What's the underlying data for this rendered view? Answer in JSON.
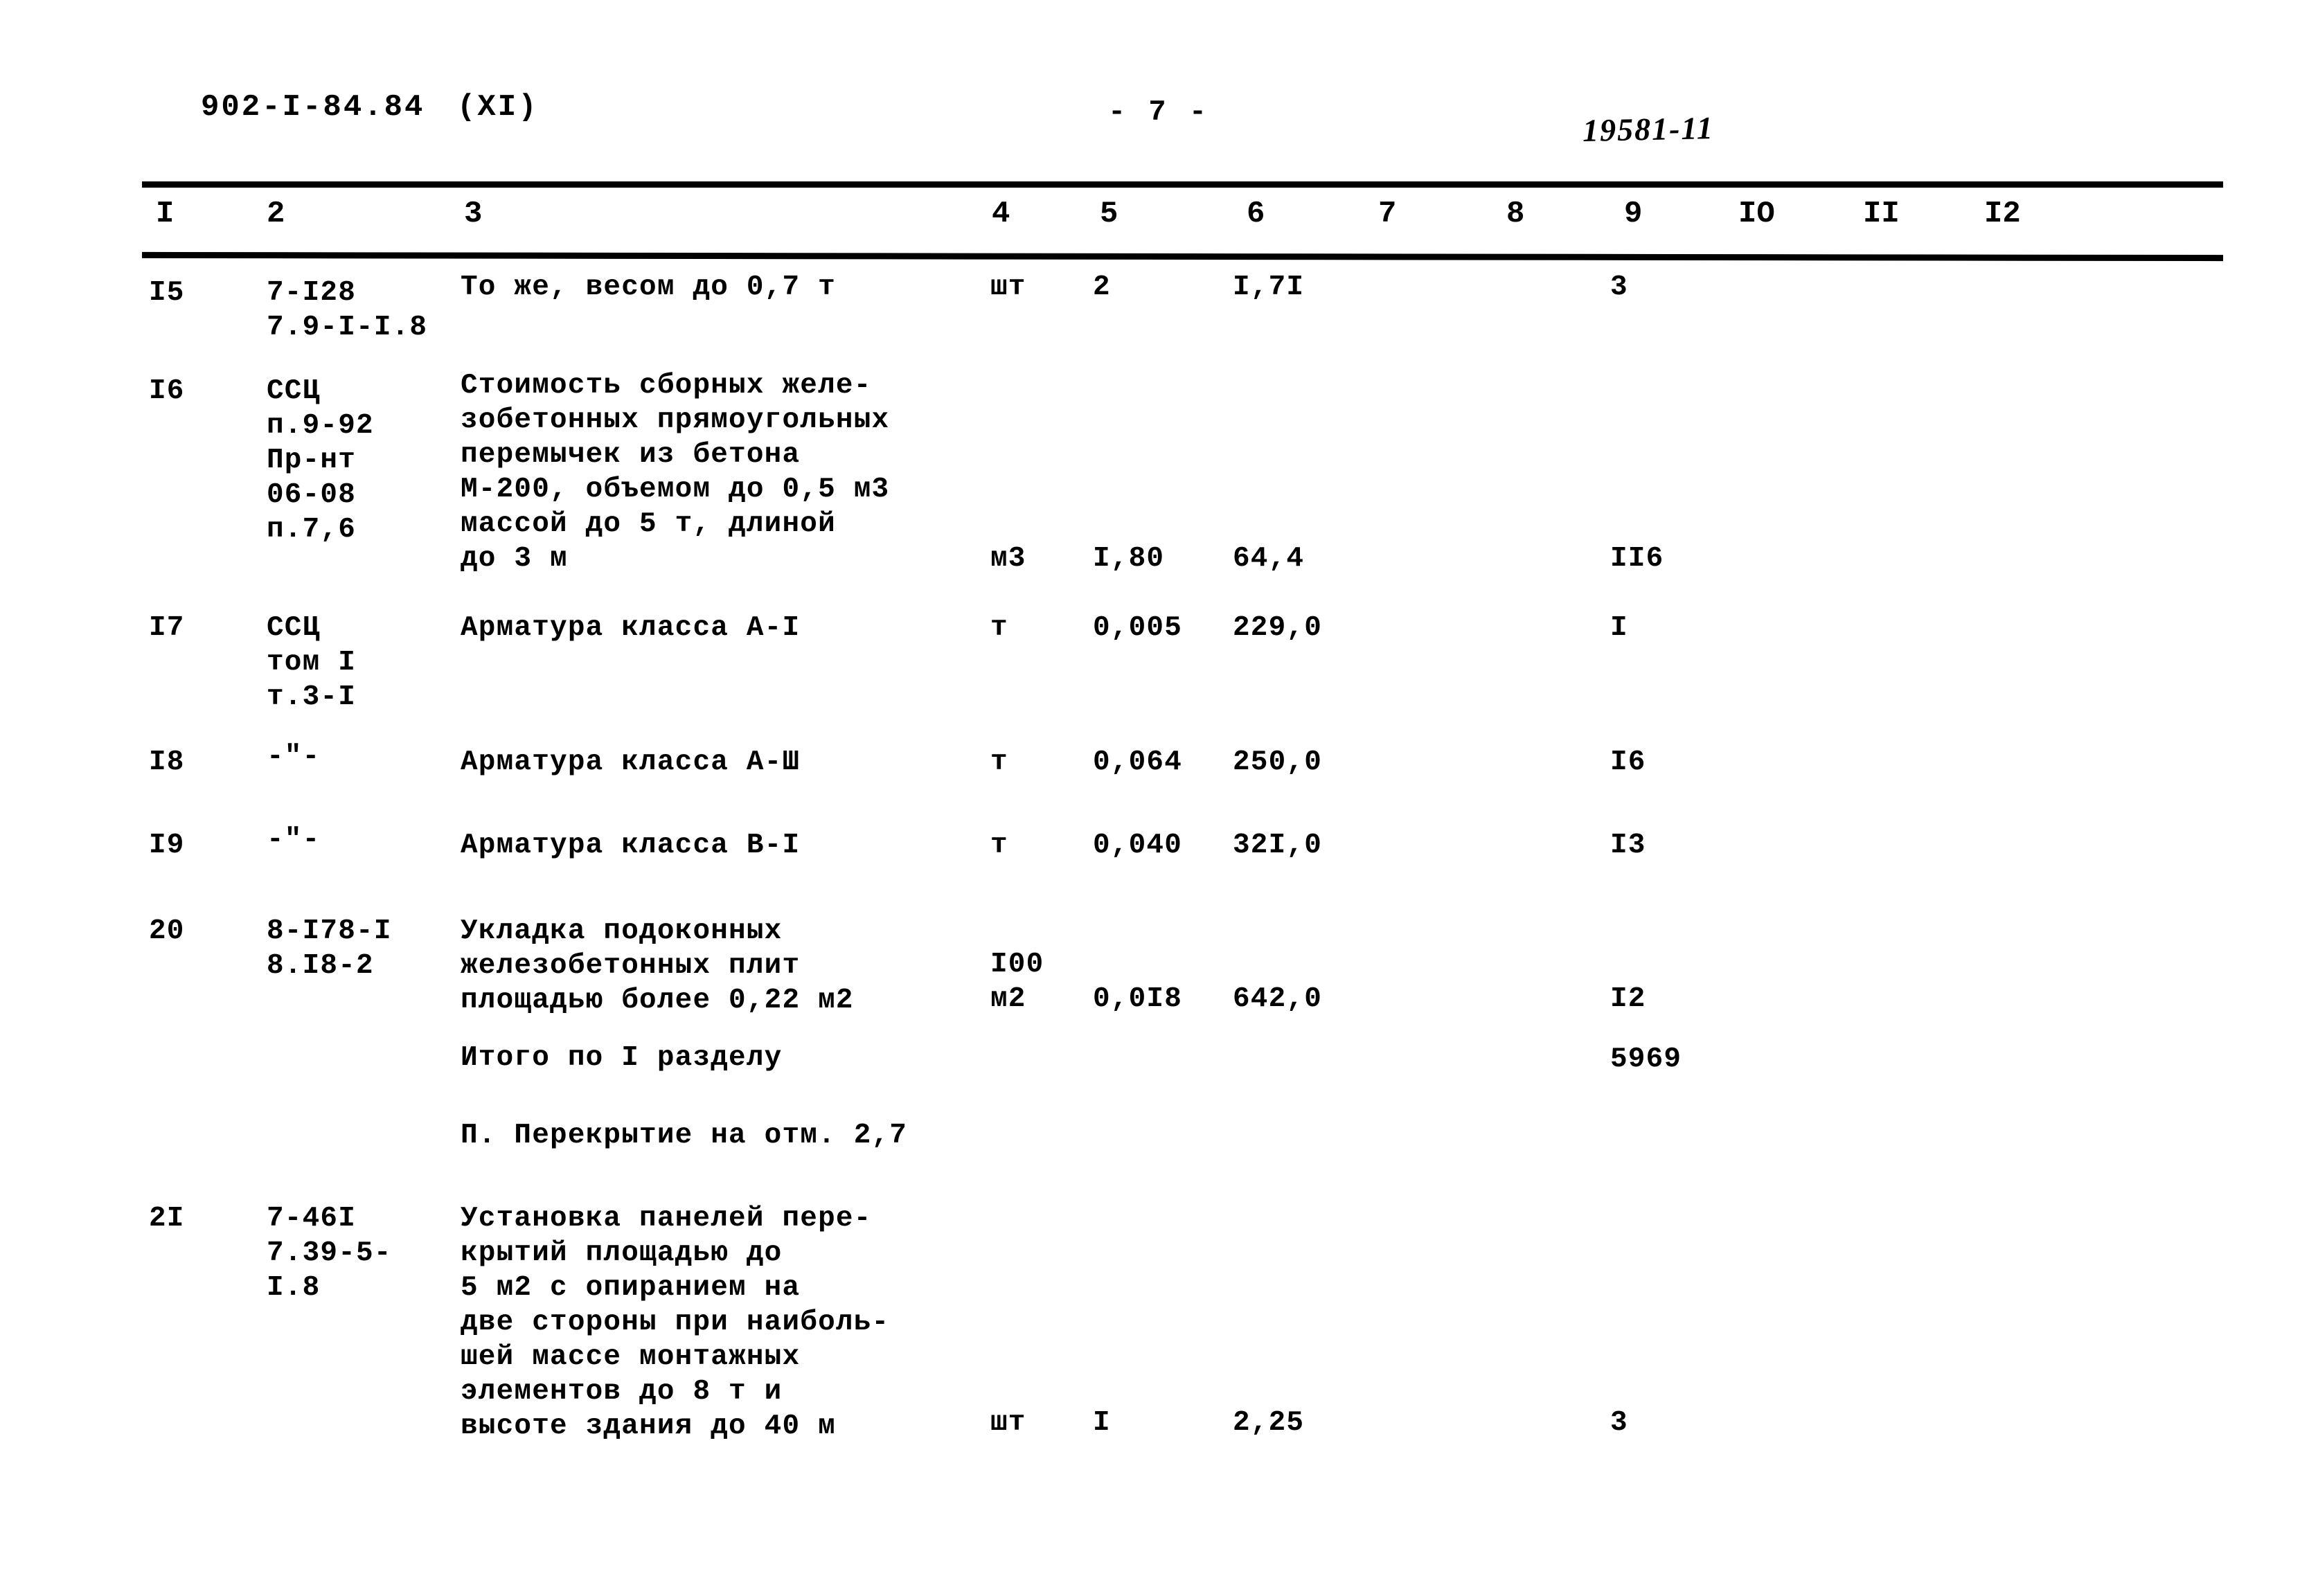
{
  "header": {
    "doc_code": "902-I-84.84",
    "volume": "(XI)",
    "page_number": "- 7 -",
    "stamp_number": "19581-11"
  },
  "table": {
    "column_headers": [
      "I",
      "2",
      "3",
      "4",
      "5",
      "6",
      "7",
      "8",
      "9",
      "IO",
      "II",
      "I2"
    ],
    "rows": [
      {
        "num": "I5",
        "code": "7-I28\n7.9-I-I.8",
        "desc": "То же, весом до 0,7 т",
        "unit": "шт",
        "qty": "2",
        "price": "I,7I",
        "col7": "",
        "col8": "",
        "col9": "3",
        "col10": "",
        "col11": "",
        "col12": ""
      },
      {
        "num": "I6",
        "code": "ССЦ\nп.9-92\nПр-нт\n06-08\nп.7,6",
        "desc": "Стоимость сборных желе-\nзобетонных прямоугольных\nперемычек из бетона\nМ-200, объемом до 0,5 м3\nмассой до 5 т, длиной\nдо 3 м",
        "unit": "м3",
        "qty": "I,80",
        "price": "64,4",
        "col7": "",
        "col8": "",
        "col9": "II6",
        "col10": "",
        "col11": "",
        "col12": ""
      },
      {
        "num": "I7",
        "code": "ССЦ\nтом I\nт.3-I",
        "desc": "Арматура класса А-I",
        "unit": "т",
        "qty": "0,005",
        "price": "229,0",
        "col7": "",
        "col8": "",
        "col9": "I",
        "col10": "",
        "col11": "",
        "col12": ""
      },
      {
        "num": "I8",
        "code": "-\"-",
        "desc": "Арматура класса А-Ш",
        "unit": "т",
        "qty": "0,064",
        "price": "250,0",
        "col7": "",
        "col8": "",
        "col9": "I6",
        "col10": "",
        "col11": "",
        "col12": ""
      },
      {
        "num": "I9",
        "code": "-\"-",
        "desc": "Арматура класса В-I",
        "unit": "т",
        "qty": "0,040",
        "price": "32I,0",
        "col7": "",
        "col8": "",
        "col9": "I3",
        "col10": "",
        "col11": "",
        "col12": ""
      },
      {
        "num": "20",
        "code": "8-I78-I\n8.I8-2",
        "desc": "Укладка подоконных\nжелезобетонных плит\nплощадью более 0,22 м2",
        "unit": "I00\nм2",
        "qty": "0,0I8",
        "price": "642,0",
        "col7": "",
        "col8": "",
        "col9": "I2",
        "col10": "",
        "col11": "",
        "col12": ""
      }
    ],
    "subtotal": {
      "label": "Итого по I разделу",
      "value": "5969"
    },
    "section_heading": "П. Перекрытие на отм. 2,7",
    "last_row": {
      "num": "2I",
      "code": "7-46I\n7.39-5-\nI.8",
      "desc": "Установка панелей пере-\nкрытий площадью до\n5 м2 с опиранием на\nдве стороны при наиболь-\nшей массе монтажных\nэлементов до 8 т и\nвысоте здания до 40 м",
      "unit": "шт",
      "qty": "I",
      "price": "2,25",
      "col7": "",
      "col8": "",
      "col9": "3",
      "col10": "",
      "col11": "",
      "col12": ""
    }
  }
}
